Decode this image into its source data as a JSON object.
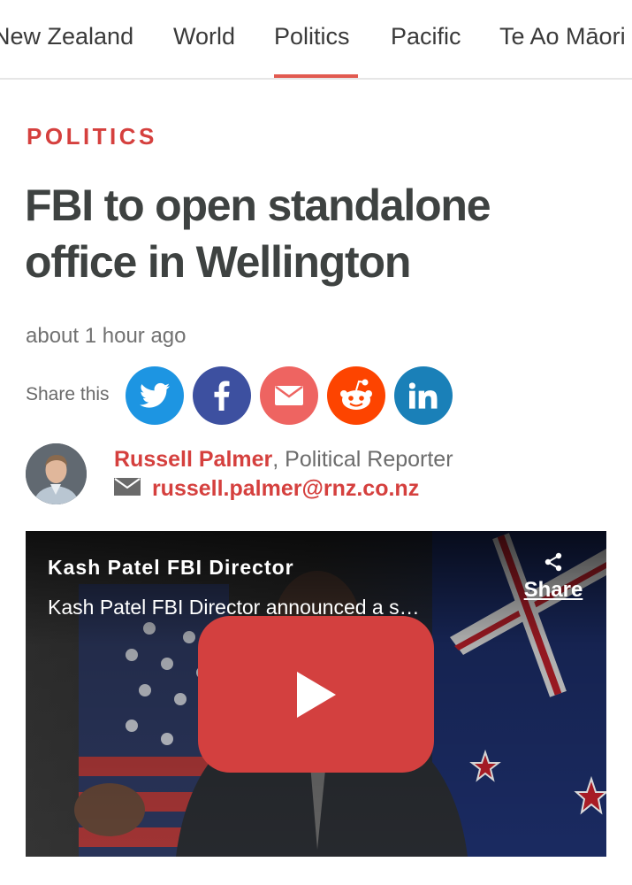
{
  "nav": {
    "items": [
      {
        "label": "New Zealand"
      },
      {
        "label": "World"
      },
      {
        "label": "Politics",
        "active": true
      },
      {
        "label": "Pacific"
      },
      {
        "label": "Te Ao Māori"
      }
    ]
  },
  "article": {
    "section": "POLITICS",
    "headline_line1": "FBI to open standalone",
    "headline_line2": "office in Wellington",
    "timestamp": "about 1 hour ago"
  },
  "share": {
    "label": "Share this",
    "buttons": [
      {
        "icon": "twitter-icon",
        "color": "#1d95e2"
      },
      {
        "icon": "facebook-icon",
        "color": "#3d50a0"
      },
      {
        "icon": "email-icon",
        "color": "#ee6461"
      },
      {
        "icon": "reddit-icon",
        "color": "#fd4400"
      },
      {
        "icon": "linkedin-icon",
        "color": "#1a80b8"
      }
    ]
  },
  "author": {
    "name": "Russell Palmer",
    "separator": ", ",
    "role": "Political Reporter",
    "email": "russell.palmer@rnz.co.nz"
  },
  "video": {
    "title": "Kash Patel FBI Director",
    "description": "Kash Patel FBI Director announced a s…",
    "share_label": "Share"
  },
  "colors": {
    "accent": "#d5403e",
    "headline": "#3e4241",
    "play_button": "#d3403f"
  }
}
